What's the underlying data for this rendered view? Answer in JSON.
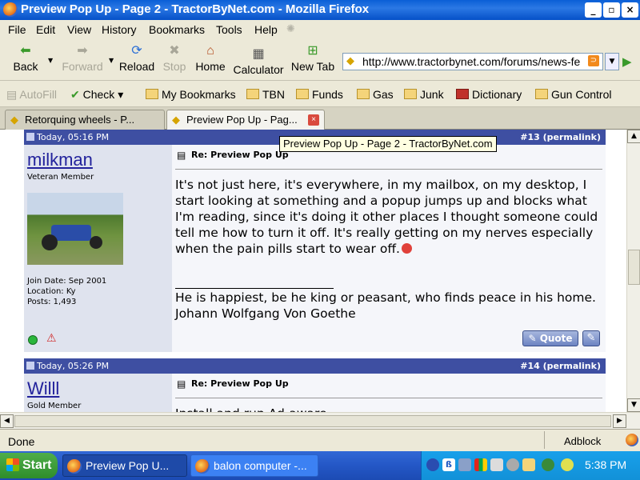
{
  "window": {
    "title": "Preview Pop Up - Page 2 - TractorByNet.com - Mozilla Firefox"
  },
  "menu": [
    "File",
    "Edit",
    "View",
    "History",
    "Bookmarks",
    "Tools",
    "Help"
  ],
  "nav": {
    "back": "Back",
    "forward": "Forward",
    "reload": "Reload",
    "stop": "Stop",
    "home": "Home",
    "calculator": "Calculator",
    "new_tab": "New Tab",
    "url": "http://www.tractorbynet.com/forums/news-fe"
  },
  "bookmarks": [
    "AutoFill",
    "Check",
    "My Bookmarks",
    "TBN",
    "Funds",
    "Gas",
    "Junk",
    "Dictionary",
    "Gun Control"
  ],
  "tabs": [
    {
      "label": "Retorquing wheels - P..."
    },
    {
      "label": "Preview Pop Up - Pag..."
    }
  ],
  "tooltip": "Preview Pop Up - Page 2 - TractorByNet.com",
  "posts": [
    {
      "date": "Today, 05:16 PM",
      "number": "#13",
      "permalink": "permalink",
      "user": "milkman",
      "rank": "Veteran Member",
      "join": "Join Date: Sep 2001",
      "location": "Location: Ky",
      "posts": "Posts: 1,493",
      "title": "Re: Preview Pop Up",
      "body": "It's not just here, it's everywhere, in my mailbox, on my desktop, I start looking at something and a popup jumps up and blocks what I'm reading, since it's doing it other places I thought someone could tell me how to turn it off. It's really getting on my nerves especially when the pain pills start to wear off.",
      "sig": "He is happiest, be he king or peasant, who finds peace in his home. Johann Wolfgang Von Goethe",
      "quote": "Quote"
    },
    {
      "date": "Today, 05:26 PM",
      "number": "#14",
      "permalink": "permalink",
      "user": "Willl",
      "rank": "Gold Member",
      "title": "Re: Preview Pop Up",
      "body": "Install and run Ad-aware"
    }
  ],
  "status": {
    "text": "Done",
    "adblock": "Adblock"
  },
  "taskbar": {
    "start": "Start",
    "tasks": [
      "Preview Pop U...",
      "balon computer -..."
    ],
    "clock": "5:38 PM"
  },
  "colors": {
    "post_header": "#3e4fa2",
    "username": "#22229c",
    "taskbar": "#2457c6"
  }
}
